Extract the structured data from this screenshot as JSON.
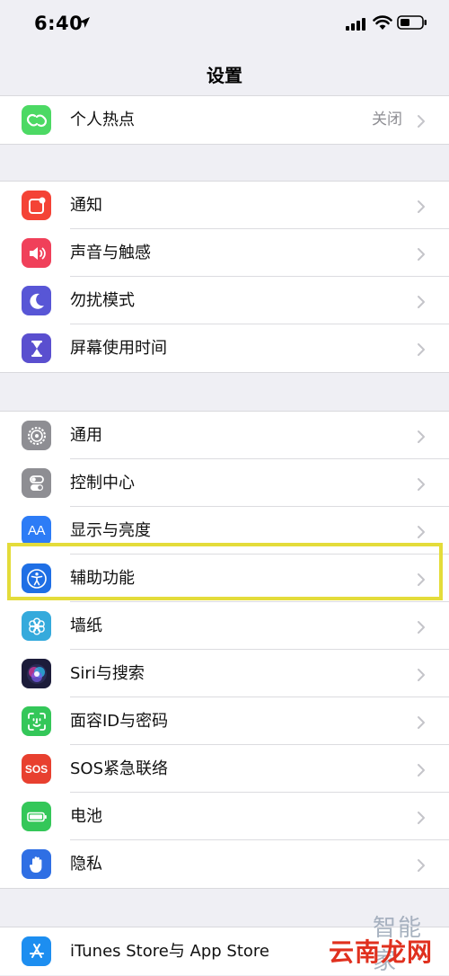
{
  "status": {
    "time": "6:40"
  },
  "nav": {
    "title": "设置"
  },
  "group1": [
    {
      "label": "个人热点",
      "value": "关闭",
      "icon": "hotspot-icon",
      "color": "#4cd964"
    }
  ],
  "group2": [
    {
      "label": "通知",
      "icon": "notifications-icon",
      "color": "#f44336"
    },
    {
      "label": "声音与触感",
      "icon": "sound-icon",
      "color": "#f0405a"
    },
    {
      "label": "勿扰模式",
      "icon": "moon-icon",
      "color": "#5856d6"
    },
    {
      "label": "屏幕使用时间",
      "icon": "hourglass-icon",
      "color": "#5a4fcf"
    }
  ],
  "group3": [
    {
      "label": "通用",
      "icon": "gear-icon",
      "color": "#8e8e93"
    },
    {
      "label": "控制中心",
      "icon": "toggles-icon",
      "color": "#8e8e93"
    },
    {
      "label": "显示与亮度",
      "icon": "text-size-icon",
      "color": "#2d7cf6"
    },
    {
      "label": "辅助功能",
      "icon": "accessibility-icon",
      "color": "#1f6fe5"
    },
    {
      "label": "墙纸",
      "icon": "flower-icon",
      "color": "#35aadc"
    },
    {
      "label": "Siri与搜索",
      "icon": "siri-icon",
      "color": "#1c1c3a"
    },
    {
      "label": "面容ID与密码",
      "icon": "face-id-icon",
      "color": "#34c759"
    },
    {
      "label": "SOS紧急联络",
      "icon": "sos-icon",
      "color": "#e8402f"
    },
    {
      "label": "电池",
      "icon": "battery-icon",
      "color": "#34c759"
    },
    {
      "label": "隐私",
      "icon": "hand-icon",
      "color": "#2f6fe4"
    }
  ],
  "group4": [
    {
      "label": "iTunes Store与 App Store",
      "icon": "app-store-icon",
      "color": "#1d8ef0"
    }
  ],
  "icon_text": {
    "sos": "SOS",
    "aa": "AA"
  },
  "watermark": {
    "top": "智能家",
    "bottom": "云南龙网"
  }
}
